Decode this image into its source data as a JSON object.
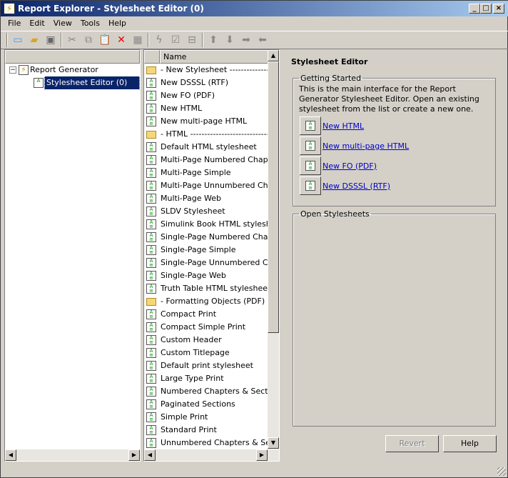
{
  "window": {
    "title": "Report Explorer - Stylesheet Editor (0)",
    "min": "_",
    "max": "□",
    "close": "×"
  },
  "menu": [
    "File",
    "Edit",
    "View",
    "Tools",
    "Help"
  ],
  "tree": {
    "root": "Report Generator",
    "child": "Stylesheet Editor (0)"
  },
  "list": {
    "column": "Name",
    "items": [
      {
        "t": "folder",
        "label": "-  New Stylesheet  ----------------------"
      },
      {
        "t": "doc",
        "label": "New DSSSL (RTF)"
      },
      {
        "t": "doc",
        "label": "New FO (PDF)"
      },
      {
        "t": "doc",
        "label": "New HTML"
      },
      {
        "t": "doc",
        "label": "New multi-page HTML"
      },
      {
        "t": "folder",
        "label": "-  HTML  --------------------------------"
      },
      {
        "t": "doc",
        "label": "Default HTML stylesheet"
      },
      {
        "t": "doc",
        "label": "Multi-Page Numbered Chapters"
      },
      {
        "t": "doc",
        "label": "Multi-Page Simple"
      },
      {
        "t": "doc",
        "label": "Multi-Page Unnumbered Chapters"
      },
      {
        "t": "doc",
        "label": "Multi-Page Web"
      },
      {
        "t": "doc",
        "label": "SLDV Stylesheet"
      },
      {
        "t": "doc",
        "label": "Simulink Book HTML stylesheet"
      },
      {
        "t": "doc",
        "label": "Single-Page Numbered Chapters"
      },
      {
        "t": "doc",
        "label": "Single-Page Simple"
      },
      {
        "t": "doc",
        "label": "Single-Page Unnumbered Chapters"
      },
      {
        "t": "doc",
        "label": "Single-Page Web"
      },
      {
        "t": "doc",
        "label": "Truth Table HTML stylesheet"
      },
      {
        "t": "folder",
        "label": "-  Formatting Objects (PDF)  -----------"
      },
      {
        "t": "doc",
        "label": "Compact Print"
      },
      {
        "t": "doc",
        "label": "Compact Simple Print"
      },
      {
        "t": "doc",
        "label": "Custom Header"
      },
      {
        "t": "doc",
        "label": "Custom Titlepage"
      },
      {
        "t": "doc",
        "label": "Default print stylesheet"
      },
      {
        "t": "doc",
        "label": "Large Type Print"
      },
      {
        "t": "doc",
        "label": "Numbered Chapters & Sections"
      },
      {
        "t": "doc",
        "label": "Paginated Sections"
      },
      {
        "t": "doc",
        "label": "Simple Print"
      },
      {
        "t": "doc",
        "label": "Standard Print"
      },
      {
        "t": "doc",
        "label": "Unnumbered Chapters & Sections"
      }
    ]
  },
  "editor": {
    "title": "Stylesheet Editor",
    "getting_started": "Getting Started",
    "description": "This is the main interface for the Report Generator Stylesheet Editor.  Open an existing stylesheet from the list or create a new one.",
    "links": [
      "New HTML",
      "New multi-page HTML",
      "New FO (PDF)",
      "New DSSSL (RTF)"
    ],
    "open_stylesheets": "Open Stylesheets",
    "revert": "Revert",
    "help": "Help"
  }
}
